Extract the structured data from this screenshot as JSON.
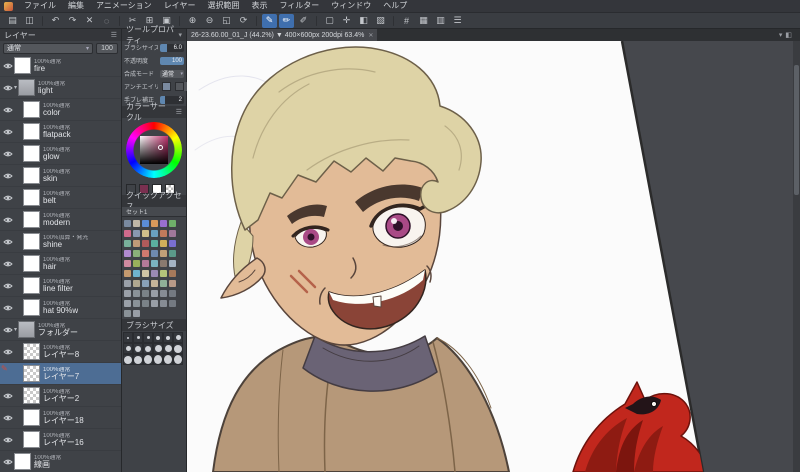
{
  "colors": {
    "accent": "#3f6fae",
    "selection": "#4d6d94",
    "panel": "#3f4247"
  },
  "menubar": {
    "items": [
      {
        "label": "ファイル"
      },
      {
        "label": "編集"
      },
      {
        "label": "アニメーション"
      },
      {
        "label": "レイヤー"
      },
      {
        "label": "選択範囲"
      },
      {
        "label": "表示"
      },
      {
        "label": "フィルター"
      },
      {
        "label": "ウィンドウ"
      },
      {
        "label": "ヘルプ"
      }
    ]
  },
  "toolbar": {
    "icons": [
      {
        "name": "open-file-icon",
        "glyph": "▤"
      },
      {
        "name": "save-icon",
        "glyph": "◫"
      },
      {
        "sep": true
      },
      {
        "name": "undo-icon",
        "glyph": "↶"
      },
      {
        "name": "redo-icon",
        "glyph": "↷"
      },
      {
        "name": "delete-icon",
        "glyph": "✕"
      },
      {
        "name": "deselect-icon",
        "glyph": "◌"
      },
      {
        "sep": true
      },
      {
        "name": "cut-icon",
        "glyph": "✂"
      },
      {
        "name": "copy-icon",
        "glyph": "⊞"
      },
      {
        "name": "paste-icon",
        "glyph": "▣"
      },
      {
        "sep": true
      },
      {
        "name": "zoom-in-icon",
        "glyph": "⊕"
      },
      {
        "name": "zoom-out-icon",
        "glyph": "⊖"
      },
      {
        "name": "fit-screen-icon",
        "glyph": "◱"
      },
      {
        "name": "rotate-canvas-icon",
        "glyph": "⟳"
      },
      {
        "sep": true
      },
      {
        "name": "pen-tool-icon",
        "glyph": "✎",
        "active": true
      },
      {
        "name": "brush-tool-icon",
        "glyph": "✏",
        "active": true
      },
      {
        "name": "airbrush-tool-icon",
        "glyph": "✐"
      },
      {
        "sep": true
      },
      {
        "name": "select-tool-icon",
        "glyph": "▢"
      },
      {
        "name": "move-tool-icon",
        "glyph": "✛"
      },
      {
        "name": "fill-tool-icon",
        "glyph": "◧"
      },
      {
        "name": "gradient-tool-icon",
        "glyph": "▧"
      },
      {
        "sep": true
      },
      {
        "name": "ruler-icon",
        "glyph": "#"
      },
      {
        "name": "grid-icon",
        "glyph": "▦"
      },
      {
        "name": "snap-icon",
        "glyph": "▥"
      },
      {
        "name": "material-icon",
        "glyph": "☰"
      }
    ]
  },
  "layers": {
    "title": "レイヤー",
    "blend": "通常",
    "opacity": "100",
    "rows": [
      {
        "op": "100%通常",
        "name": "fire"
      },
      {
        "op": "100%通常",
        "name": "light",
        "folder": true
      },
      {
        "op": "100%通常",
        "name": "color",
        "indent": 1
      },
      {
        "op": "100%通常",
        "name": "flatpack",
        "indent": 1
      },
      {
        "op": "100%通常",
        "name": "glow",
        "indent": 1
      },
      {
        "op": "100%通常",
        "name": "skin",
        "indent": 1
      },
      {
        "op": "100%通常",
        "name": "belt",
        "indent": 1
      },
      {
        "op": "100%通常",
        "name": "modern",
        "indent": 1
      },
      {
        "op": "100%加算・発光",
        "name": "shine",
        "indent": 1
      },
      {
        "op": "100%通常",
        "name": "hair",
        "indent": 1
      },
      {
        "op": "100%通常",
        "name": "line filter",
        "indent": 1
      },
      {
        "op": "100%通常",
        "name": "hat 90%w",
        "indent": 1
      },
      {
        "op": "100%通常",
        "name": "フォルダー",
        "folder": true
      },
      {
        "op": "100%通常",
        "name": "レイヤー8",
        "indent": 1,
        "checker": true
      },
      {
        "op": "100%通常",
        "name": "レイヤー7",
        "indent": 1,
        "selected": true,
        "pen": true,
        "checker": true
      },
      {
        "op": "100%通常",
        "name": "レイヤー2",
        "indent": 1,
        "checker": true
      },
      {
        "op": "100%通常",
        "name": "レイヤー18",
        "indent": 1
      },
      {
        "op": "100%通常",
        "name": "レイヤー16",
        "indent": 1
      },
      {
        "op": "100%通常",
        "name": "線画"
      }
    ]
  },
  "tool_property": {
    "title": "ツールプロパティ",
    "rows": [
      {
        "label": "ブラシサイズ",
        "value": "6.0",
        "kind": "slider",
        "pct": 30
      },
      {
        "label": "不透明度",
        "value": "100",
        "kind": "slider",
        "pct": 100
      },
      {
        "label": "合成モード",
        "value": "通常",
        "kind": "dropdown"
      },
      {
        "label": "アンチエイリアス",
        "value": "",
        "kind": "squares"
      },
      {
        "label": "手ブレ補正",
        "value": "2",
        "kind": "slider",
        "pct": 20
      }
    ]
  },
  "color_panel": {
    "title": "カラーサークル",
    "fg": "#7a3050",
    "bg": "#ffffff"
  },
  "quick_access": {
    "title": "クイックアクセス",
    "set": "セット1",
    "icons": [
      {
        "color": "#7a8aa0"
      },
      {
        "color": "#c0b7a6"
      },
      {
        "color": "#5b8dd9"
      },
      {
        "color": "#d9995b"
      },
      {
        "color": "#9a6fd0"
      },
      {
        "color": "#6fb06a"
      },
      {
        "color": "#d06a8c"
      },
      {
        "color": "#8898b0"
      },
      {
        "color": "#d0c08a"
      },
      {
        "color": "#6aa0c0"
      },
      {
        "color": "#c07a5b"
      },
      {
        "color": "#a0789a"
      },
      {
        "color": "#78b09a"
      },
      {
        "color": "#c09a78"
      },
      {
        "color": "#b05b5b"
      },
      {
        "color": "#5bb0a0"
      },
      {
        "color": "#d0b05b"
      },
      {
        "color": "#7a6fd0"
      },
      {
        "color": "#b08ad0"
      },
      {
        "color": "#8ab07a"
      },
      {
        "color": "#d07a6f"
      },
      {
        "color": "#6f8ab0"
      },
      {
        "color": "#c0a078"
      },
      {
        "color": "#5b9a8a"
      },
      {
        "color": "#d08aa0"
      },
      {
        "color": "#9ab05b"
      },
      {
        "color": "#b47a9a"
      },
      {
        "color": "#7ab4c0"
      },
      {
        "color": "#8a7a6f"
      },
      {
        "color": "#a4b4c4"
      },
      {
        "color": "#c49a6f"
      },
      {
        "color": "#6fb4d0"
      },
      {
        "color": "#d0c4a4"
      },
      {
        "color": "#9a8ab4"
      },
      {
        "color": "#b4c47a"
      },
      {
        "color": "#a67a5b"
      },
      {
        "color": "#9aa0a8"
      },
      {
        "color": "#b0a890"
      },
      {
        "color": "#88a0b8"
      },
      {
        "color": "#c4b49a"
      },
      {
        "color": "#90b098"
      },
      {
        "color": "#b89a88"
      },
      {
        "color": "#9aa0a8"
      },
      {
        "color": "#8a9298"
      },
      {
        "color": "#7a8288"
      },
      {
        "color": "#989ea6"
      },
      {
        "color": "#868c94"
      },
      {
        "color": "#747a82"
      },
      {
        "color": "#9aa0a8"
      },
      {
        "color": "#8a9298"
      },
      {
        "color": "#7a8288"
      },
      {
        "color": "#989ea6"
      },
      {
        "color": "#868c94"
      },
      {
        "color": "#747a82"
      },
      {
        "color": "#8a9298"
      },
      {
        "color": "#989ea6"
      }
    ]
  },
  "brush_size": {
    "title": "ブラシサイズ",
    "sizes": [
      {
        "size": 2
      },
      {
        "size": 3
      },
      {
        "size": 3
      },
      {
        "size": 4
      },
      {
        "size": 4
      },
      {
        "size": 5
      },
      {
        "size": 5
      },
      {
        "size": 6
      },
      {
        "size": 6
      },
      {
        "size": 7
      },
      {
        "size": 7
      },
      {
        "size": 8
      },
      {
        "size": 8
      },
      {
        "size": 8
      },
      {
        "size": 9
      },
      {
        "size": 9
      },
      {
        "size": 9
      },
      {
        "size": 9
      }
    ]
  },
  "canvas": {
    "tab_title": "26-23.60.00_01_J (44.2%) ▼ 400×600px 200dpi 63.4%",
    "tab_close": "✕",
    "corner_a": "▾",
    "corner_b": "◧"
  },
  "artwork": {
    "bg": "#46484d",
    "paper": "#fbfbfb",
    "edge": "#2b2b2b",
    "skin": "#e2bb97",
    "skin_line": "#5a463c",
    "hair": "#ded3a6",
    "hair_line": "#6d6049",
    "hair_strand": "#b9ad85",
    "brow": "#4a382e",
    "iris": "#a94a86",
    "pupil": "#2e1128",
    "sclera": "#f8f4ef",
    "lash": "#32251f",
    "mouth": "#8a4437",
    "teeth": "#fdfdf8",
    "cheek": "#b5624a",
    "collar": "#6a6375",
    "collar_line": "#443c42",
    "jacket": "#b69879",
    "jacket_line": "#4d423a",
    "jacket_seam": "#7d6448",
    "bird_red": "#c1271d",
    "bird_line": "#6d120c",
    "wing": "#8e1b12",
    "wing2": "#7c150e",
    "bird_face": "#231418"
  }
}
